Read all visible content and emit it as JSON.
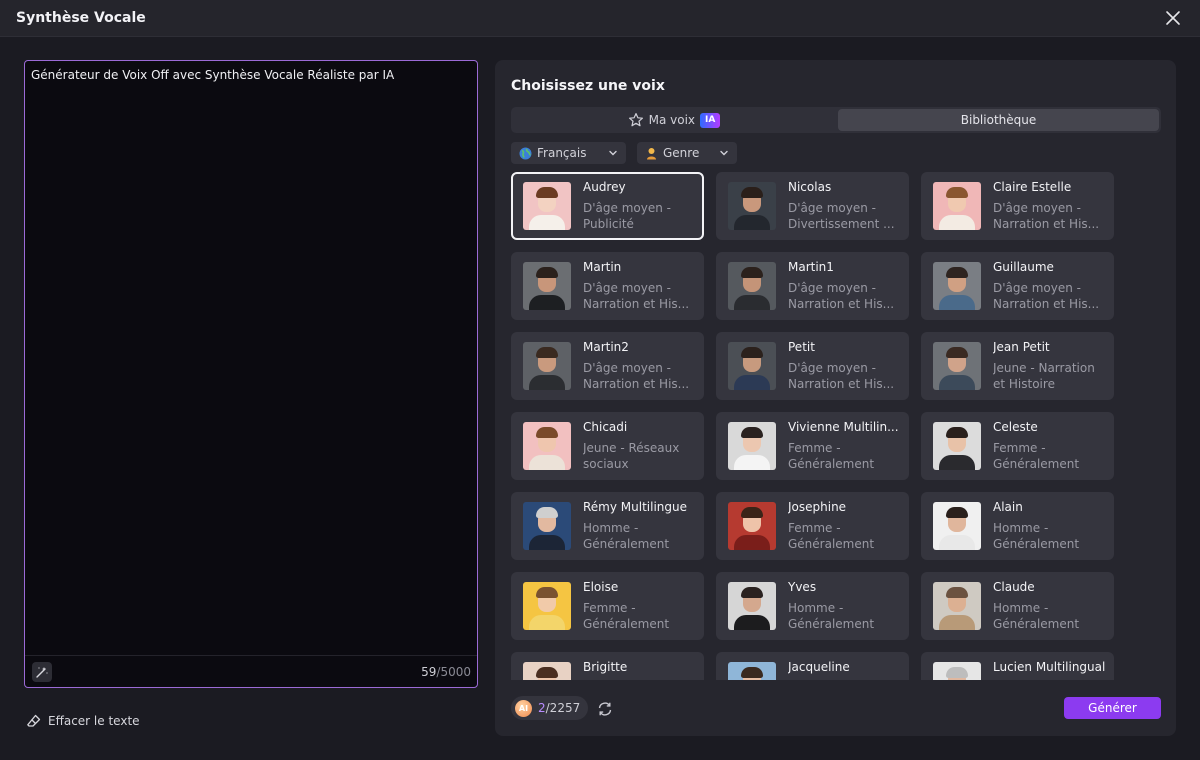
{
  "window": {
    "title": "Synthèse Vocale"
  },
  "editor": {
    "text": "Générateur de Voix Off avec Synthèse Vocale Réaliste par IA",
    "count_current": "59",
    "count_max": "/5000",
    "clear_label": "Effacer le texte"
  },
  "panel": {
    "title": "Choisissez une voix",
    "tabs": [
      {
        "label": "Ma voix",
        "badge": "IA",
        "active": false
      },
      {
        "label": "Bibliothèque",
        "active": true
      }
    ],
    "filters": {
      "language": "Français",
      "gender": "Genre"
    },
    "voices": [
      {
        "name": "Audrey",
        "desc1": "D'âge moyen -",
        "desc2": "Publicité",
        "selected": true,
        "bg": "#f1c4c4",
        "skin": "#f3d2c1",
        "hair": "#6b3b22",
        "shirt": "#f5f0ea"
      },
      {
        "name": "Nicolas",
        "desc1": "D'âge moyen -",
        "desc2": "Divertissement ...",
        "bg": "#3a4048",
        "skin": "#c9987c",
        "hair": "#2a1f1a",
        "shirt": "#23272e"
      },
      {
        "name": "Claire Estelle",
        "desc1": "D'âge moyen -",
        "desc2": "Narration et His...",
        "bg": "#f0b7b7",
        "skin": "#f0c9b0",
        "hair": "#8a5630",
        "shirt": "#f3ebe3"
      },
      {
        "name": "Martin",
        "desc1": "D'âge moyen -",
        "desc2": "Narration et His...",
        "bg": "#6b6e72",
        "skin": "#c8967a",
        "hair": "#2b211c",
        "shirt": "#1d1f22"
      },
      {
        "name": "Martin1",
        "desc1": "D'âge moyen -",
        "desc2": "Narration et His...",
        "bg": "#55595e",
        "skin": "#c49478",
        "hair": "#2b211c",
        "shirt": "#2a2c30"
      },
      {
        "name": "Guillaume",
        "desc1": "D'âge moyen -",
        "desc2": "Narration et His...",
        "bg": "#7a7e84",
        "skin": "#d0a083",
        "hair": "#2e2420",
        "shirt": "#4a6a8a"
      },
      {
        "name": "Martin2",
        "desc1": "D'âge moyen -",
        "desc2": "Narration et His...",
        "bg": "#5e6166",
        "skin": "#c99a7e",
        "hair": "#3a2a20",
        "shirt": "#2b2d31"
      },
      {
        "name": "Petit",
        "desc1": "D'âge moyen -",
        "desc2": "Narration et His...",
        "bg": "#4b4f55",
        "skin": "#c79a7e",
        "hair": "#2b211c",
        "shirt": "#2c3a55"
      },
      {
        "name": "Jean Petit",
        "desc1": "Jeune - Narration",
        "desc2": "et Histoire",
        "bg": "#6e7277",
        "skin": "#d0a38a",
        "hair": "#3a2a22",
        "shirt": "#3c4a5a"
      },
      {
        "name": "Chicadi",
        "desc1": "Jeune - Réseaux",
        "desc2": "sociaux",
        "bg": "#f2c0c0",
        "skin": "#efc6ae",
        "hair": "#7a4a2a",
        "shirt": "#ece2d8"
      },
      {
        "name": "Vivienne Multilin...",
        "desc1": "Femme -",
        "desc2": "Généralement",
        "bg": "#d9d9d9",
        "skin": "#ecc7b0",
        "hair": "#2a2220",
        "shirt": "#f4f4f4"
      },
      {
        "name": "Celeste",
        "desc1": "Femme -",
        "desc2": "Généralement",
        "bg": "#dcdcdc",
        "skin": "#e8c2a8",
        "hair": "#2a201c",
        "shirt": "#2a2a2e"
      },
      {
        "name": "Rémy Multilingue",
        "desc1": "Homme -",
        "desc2": "Généralement",
        "bg": "#2b4a78",
        "skin": "#e2b9a0",
        "hair": "#cfcfcf",
        "shirt": "#1c2536"
      },
      {
        "name": "Josephine",
        "desc1": "Femme -",
        "desc2": "Généralement",
        "bg": "#b63a30",
        "skin": "#eec3a9",
        "hair": "#3a2418",
        "shirt": "#7a1e1a"
      },
      {
        "name": "Alain",
        "desc1": "Homme -",
        "desc2": "Généralement",
        "bg": "#f0f0f0",
        "skin": "#e0b69c",
        "hair": "#2a201c",
        "shirt": "#e8e8e8"
      },
      {
        "name": "Eloise",
        "desc1": "Femme -",
        "desc2": "Généralement",
        "bg": "#f5c542",
        "skin": "#f1caa9",
        "hair": "#7a5230",
        "shirt": "#f3d56a"
      },
      {
        "name": "Yves",
        "desc1": "Homme -",
        "desc2": "Généralement",
        "bg": "#d6d6d6",
        "skin": "#d4a88e",
        "hair": "#2a2220",
        "shirt": "#1c1c1e"
      },
      {
        "name": "Claude",
        "desc1": "Homme -",
        "desc2": "Généralement",
        "bg": "#cfcac2",
        "skin": "#dcb092",
        "hair": "#6b5240",
        "shirt": "#b89a78"
      },
      {
        "name": "Brigitte",
        "desc1": "",
        "desc2": "",
        "bg": "#e8d2c4",
        "skin": "#ecc4aa",
        "hair": "#4a2e20",
        "shirt": "#e8e0d8"
      },
      {
        "name": "Jacqueline",
        "desc1": "",
        "desc2": "",
        "bg": "#8fb6d8",
        "skin": "#e7bea4",
        "hair": "#3a2a20",
        "shirt": "#dfe6ee"
      },
      {
        "name": "Lucien Multilingual",
        "desc1": "",
        "desc2": "",
        "bg": "#e6e6e6",
        "skin": "#e0b8a0",
        "hair": "#bdbdbd",
        "shirt": "#3a3a40"
      }
    ],
    "credits": {
      "icon": "AI",
      "used": "2",
      "total": "/2257"
    },
    "generate_label": "Générer"
  },
  "colors": {
    "accent": "#8c3bf0",
    "editor_border": "#9b6ad6",
    "panel_bg": "#26262e",
    "card_bg": "#35353e"
  }
}
